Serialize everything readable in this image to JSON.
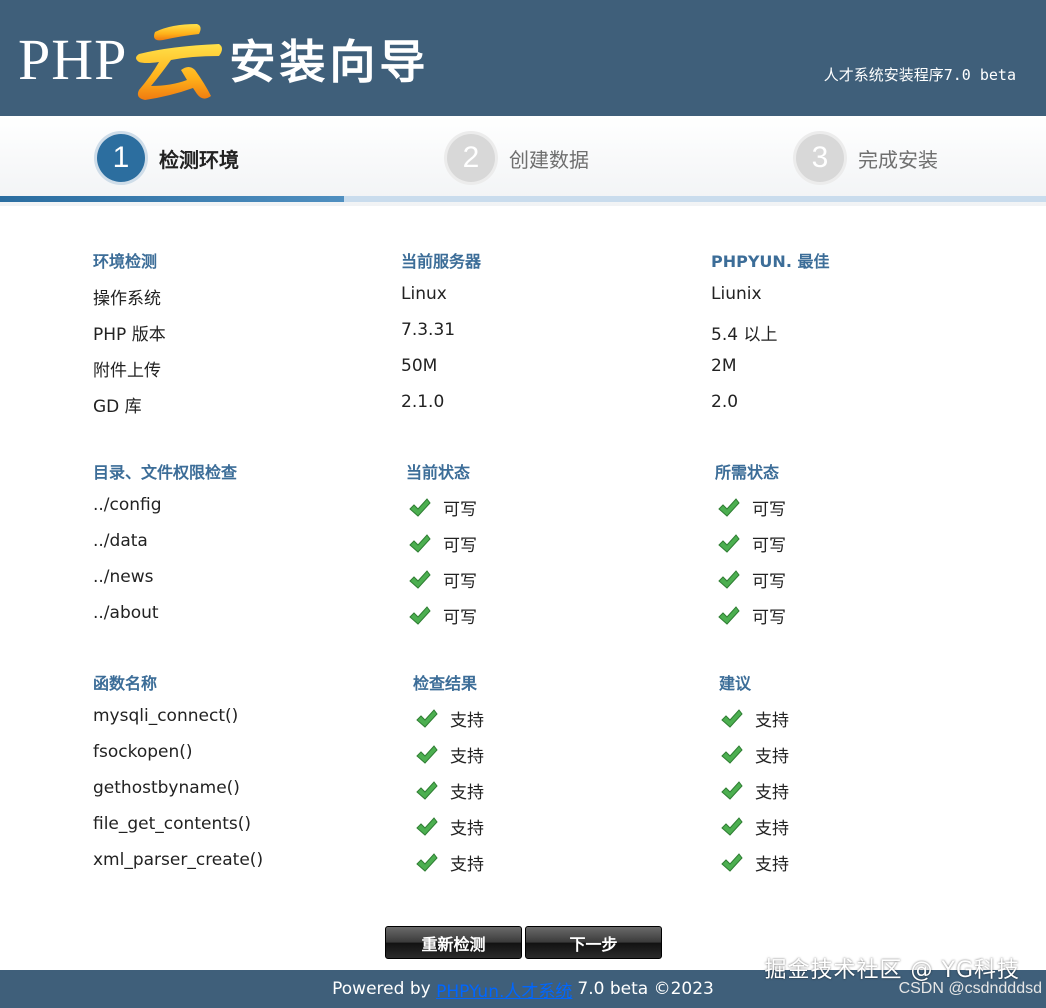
{
  "header": {
    "logo_php": "PHP",
    "logo_cn": "安装向导",
    "subtitle": "人才系统安装程序7.0 beta"
  },
  "steps": [
    {
      "num": "1",
      "label": "检测环境",
      "state": "active"
    },
    {
      "num": "2",
      "label": "创建数据",
      "state": "inactive"
    },
    {
      "num": "3",
      "label": "完成安装",
      "state": "inactive"
    }
  ],
  "env": {
    "headers": [
      "环境检测",
      "当前服务器",
      "PHPYUN. 最佳"
    ],
    "rows": [
      [
        "操作系统",
        "Linux",
        "Liunix"
      ],
      [
        "PHP 版本",
        "7.3.31",
        "5.4 以上"
      ],
      [
        "附件上传",
        "50M",
        "2M"
      ],
      [
        "GD 库",
        "2.1.0",
        "2.0"
      ]
    ]
  },
  "perms": {
    "headers": [
      "目录、文件权限检查",
      "当前状态",
      "所需状态"
    ],
    "rows": [
      [
        "../config",
        "可写",
        "可写"
      ],
      [
        "../data",
        "可写",
        "可写"
      ],
      [
        "../news",
        "可写",
        "可写"
      ],
      [
        "../about",
        "可写",
        "可写"
      ]
    ]
  },
  "funcs": {
    "headers": [
      "函数名称",
      "检查结果",
      "建议"
    ],
    "rows": [
      [
        "mysqli_connect()",
        "支持",
        "支持"
      ],
      [
        "fsockopen()",
        "支持",
        "支持"
      ],
      [
        "gethostbyname()",
        "支持",
        "支持"
      ],
      [
        "file_get_contents()",
        "支持",
        "支持"
      ],
      [
        "xml_parser_create()",
        "支持",
        "支持"
      ]
    ]
  },
  "buttons": {
    "recheck": "重新检测",
    "next": "下一步"
  },
  "footer": {
    "prefix": "Powered by",
    "link": "PHPYun.人才系统",
    "suffix": "7.0 beta ©2023"
  },
  "watermark": {
    "line1": "掘金技术社区 @ YG科技",
    "line2": "CSDN @csdndddsd"
  },
  "colors": {
    "header_bg": "#3f5f7a",
    "accent": "#2c6e9f",
    "section_head": "#3c6d98",
    "check": "#4caf50"
  }
}
